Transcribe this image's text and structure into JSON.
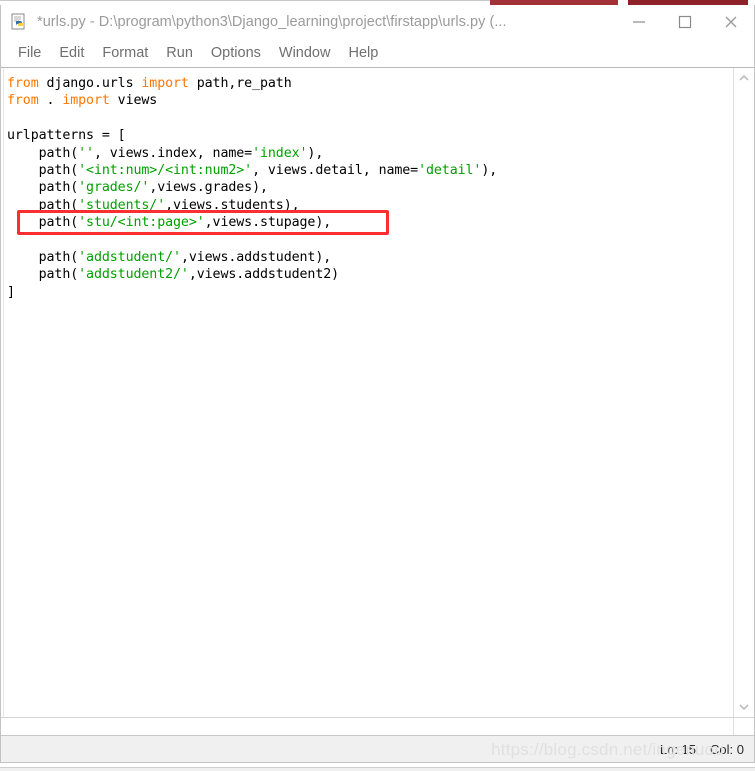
{
  "window": {
    "title": "*urls.py - D:\\program\\python3\\Django_learning\\project\\firstapp\\urls.py (...",
    "icon": "python-idle-icon",
    "controls": {
      "minimize_label": "Minimize",
      "maximize_label": "Maximize",
      "close_label": "Close"
    }
  },
  "menubar": {
    "items": [
      {
        "label": "File"
      },
      {
        "label": "Edit"
      },
      {
        "label": "Format"
      },
      {
        "label": "Run"
      },
      {
        "label": "Options"
      },
      {
        "label": "Window"
      },
      {
        "label": "Help"
      }
    ]
  },
  "editor": {
    "lines": [
      [
        {
          "t": "from",
          "c": "kw"
        },
        {
          "t": " django.urls ",
          "c": "pl"
        },
        {
          "t": "import",
          "c": "kw"
        },
        {
          "t": " path,re_path",
          "c": "pl"
        }
      ],
      [
        {
          "t": "from",
          "c": "kw"
        },
        {
          "t": " . ",
          "c": "pl"
        },
        {
          "t": "import",
          "c": "kw"
        },
        {
          "t": " views",
          "c": "pl"
        }
      ],
      [],
      [
        {
          "t": "urlpatterns = [",
          "c": "pl"
        }
      ],
      [
        {
          "t": "    path(",
          "c": "pl"
        },
        {
          "t": "''",
          "c": "str"
        },
        {
          "t": ", views.index, name=",
          "c": "pl"
        },
        {
          "t": "'index'",
          "c": "str"
        },
        {
          "t": "),",
          "c": "pl"
        }
      ],
      [
        {
          "t": "    path(",
          "c": "pl"
        },
        {
          "t": "'<int:num>/<int:num2>'",
          "c": "str"
        },
        {
          "t": ", views.detail, name=",
          "c": "pl"
        },
        {
          "t": "'detail'",
          "c": "str"
        },
        {
          "t": "),",
          "c": "pl"
        }
      ],
      [
        {
          "t": "    path(",
          "c": "pl"
        },
        {
          "t": "'grades/'",
          "c": "str"
        },
        {
          "t": ",views.grades),",
          "c": "pl"
        }
      ],
      [
        {
          "t": "    path(",
          "c": "pl"
        },
        {
          "t": "'students/'",
          "c": "str"
        },
        {
          "t": ",views.students),",
          "c": "pl"
        }
      ],
      [
        {
          "t": "    path(",
          "c": "pl"
        },
        {
          "t": "'stu/<int:page>'",
          "c": "str"
        },
        {
          "t": ",views.stupage),",
          "c": "pl"
        }
      ],
      [],
      [
        {
          "t": "    path(",
          "c": "pl"
        },
        {
          "t": "'addstudent/'",
          "c": "str"
        },
        {
          "t": ",views.addstudent),",
          "c": "pl"
        }
      ],
      [
        {
          "t": "    path(",
          "c": "pl"
        },
        {
          "t": "'addstudent2/'",
          "c": "str"
        },
        {
          "t": ",views.addstudent2)",
          "c": "pl"
        }
      ],
      [
        {
          "t": "]",
          "c": "pl"
        }
      ]
    ],
    "annotation": {
      "name": "red-highlight-box",
      "color": "#fb2f2f",
      "target_line": "path('stu/<int:page>',views.stupage),"
    }
  },
  "scrollbar": {
    "up_arrow": "chevron-up-icon",
    "down_arrow": "chevron-down-icon"
  },
  "statusbar": {
    "line": "Ln: 15",
    "col": "Col: 0"
  },
  "watermark": {
    "text": "https://blog.csdn.net/ingenuou"
  },
  "colors": {
    "keyword": "#ff7700",
    "string": "#00a000",
    "plain": "#000000",
    "annotation": "#fb2f2f",
    "title_text": "#9b9b9b",
    "menu_text": "#6f6f6f"
  }
}
